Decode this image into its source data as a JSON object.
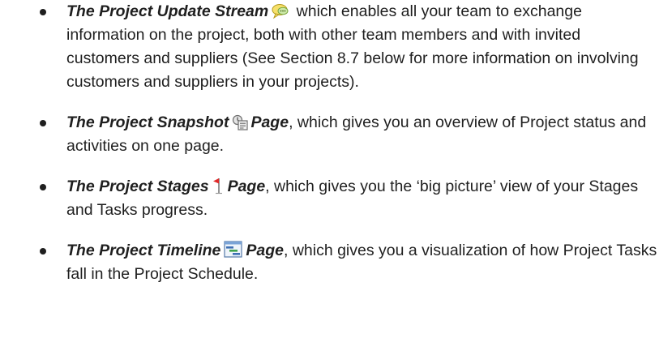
{
  "items": [
    {
      "title": "The Project Update Stream",
      "icon": "chat-bubbles-icon",
      "suffix": "",
      "text": " which enables all your team to exchange information on the project, both with other team members and with invited customers and suppliers (See Section 8.7 below for more information on involving customers and suppliers in your projects)."
    },
    {
      "title": "The Project Snapshot",
      "icon": "snapshot-icon",
      "suffix": "Page",
      "text": ", which gives you an overview of Project status and activities on one page."
    },
    {
      "title": "The Project Stages",
      "icon": "red-flag-icon",
      "suffix": "Page",
      "text": ", which gives you the ‘big picture’ view of your Stages and Tasks progress."
    },
    {
      "title": "The Project Timeline",
      "icon": "timeline-icon",
      "suffix": "Page",
      "text": ", which gives you a visualization of how Project Tasks fall in the Project Schedule."
    }
  ]
}
